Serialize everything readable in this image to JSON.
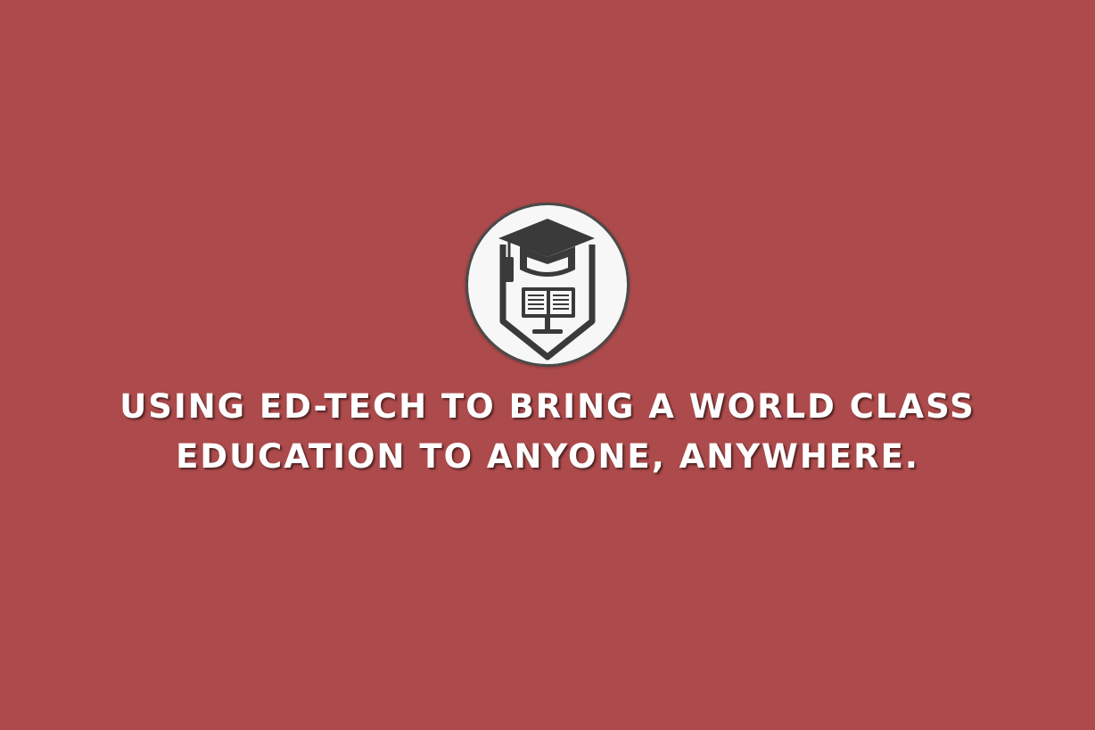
{
  "page": {
    "background_color": "#ad4a4b"
  },
  "logo": {
    "icon": "graduation-cap-shield-book-icon",
    "ring_color": "#4a4a4a",
    "fill_color": "#f7f7f7",
    "icon_color": "#3a3a3a"
  },
  "tagline": {
    "line1": "USING ED-TECH TO BRING A WORLD CLASS",
    "line2": "EDUCATION TO ANYONE, ANYWHERE.",
    "color": "#ffffff"
  }
}
